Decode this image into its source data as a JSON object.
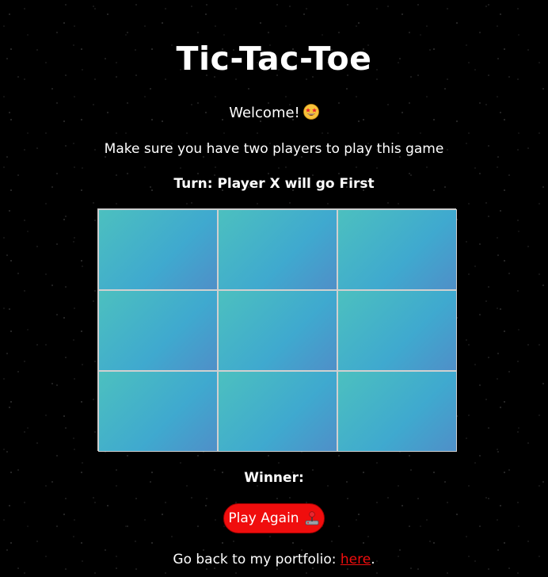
{
  "header": {
    "title": "Tic-Tac-Toe"
  },
  "intro": {
    "welcome": "Welcome!",
    "welcome_icon": "star-struck-emoji-icon",
    "instructions": "Make sure you have two players to play this game",
    "turn": "Turn: Player X will go First"
  },
  "board": {
    "cells": [
      "",
      "",
      "",
      "",
      "",
      "",
      "",
      "",
      ""
    ],
    "cell_gradient": [
      "#4cc0bf",
      "#3fa9cf",
      "#4f8fc8"
    ],
    "grid_line_color": "#d0d0d0"
  },
  "result": {
    "winner": "Winner:"
  },
  "play_again": {
    "label": "Play Again",
    "icon": "joystick-icon",
    "color": "#f00d0d"
  },
  "footer": {
    "text": "Go back to my portfolio: ",
    "link_label": "here",
    "end": ".",
    "link_color": "#f00d0d"
  },
  "background": {
    "color": "#000000",
    "style": "starfield"
  }
}
